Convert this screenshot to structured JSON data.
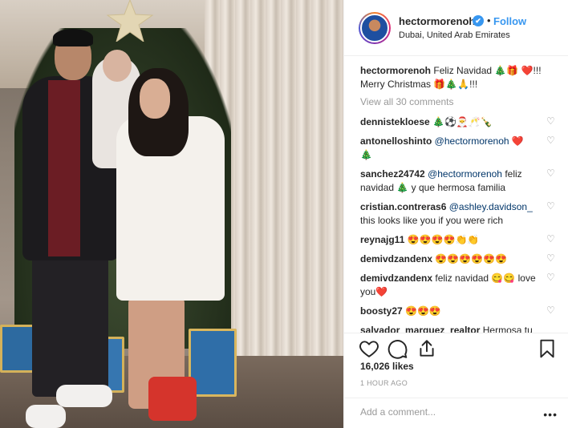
{
  "post": {
    "username": "hectormorenoh",
    "verified_mark": "✔",
    "separator": "•",
    "follow_label": "Follow",
    "location": "Dubai, United Arab Emirates",
    "caption_user": "hectormorenoh",
    "caption_text": "Feliz Navidad 🎄🎁 ❤️!!! Merry Christmas 🎁🎄🙏!!!",
    "view_all": "View all 30 comments",
    "likes": "16,026 likes",
    "time": "1 HOUR AGO",
    "add_comment_placeholder": "Add a comment...",
    "more_label": "•••"
  },
  "comments": [
    {
      "user": "dennistekloese",
      "text": "🎄⚽🎅🥂🍾"
    },
    {
      "user": "antonelloshinto",
      "mention": "@hectormorenoh",
      "text": "❤️ 🎄"
    },
    {
      "user": "sanchez24742",
      "mention": "@hectormorenoh",
      "text": "feliz navidad 🎄 y que hermosa familia"
    },
    {
      "user": "cristian.contreras6",
      "mention": "@ashley.davidson_",
      "text": "this looks like you if you were rich"
    },
    {
      "user": "reynajg11",
      "text": "😍😍😍😍👏👏"
    },
    {
      "user": "demivdzandenx",
      "text": "😍😍😍😍😍😍"
    },
    {
      "user": "demivdzandenx",
      "text": "feliz navidad 😋😋 love you❤️"
    },
    {
      "user": "boosty27",
      "text": "😍😍😍"
    },
    {
      "user": "salvador_marquez_realtor",
      "text": "Hermosa tu familia. Felicidades"
    }
  ],
  "icons": {
    "like": "heart-outline-icon",
    "comment": "comment-bubble-icon",
    "share": "share-icon",
    "save": "bookmark-icon",
    "comment_like": "♡"
  },
  "colors": {
    "accent": "#3897f0",
    "text": "#262626",
    "muted": "#999999",
    "mention": "#003569"
  }
}
